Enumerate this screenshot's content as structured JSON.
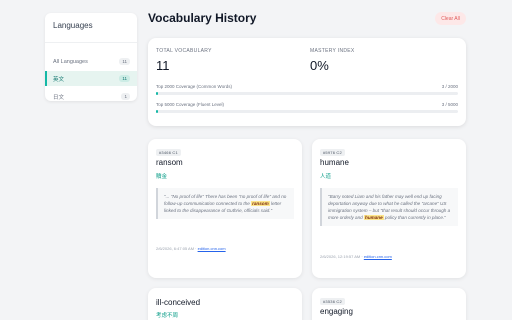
{
  "sidebar": {
    "title": "Languages",
    "items": [
      {
        "label": "All Languages",
        "count": "11"
      },
      {
        "label": "英文",
        "count": "11"
      },
      {
        "label": "日文",
        "count": "1"
      }
    ]
  },
  "header": {
    "title": "Vocabulary History",
    "clear_label": "Clear All"
  },
  "stats": {
    "total_label": "TOTAL VOCABULARY",
    "total_value": "11",
    "mastery_label": "MASTERY INDEX",
    "mastery_value": "0%",
    "coverage": [
      {
        "label": "Top 2000 Coverage (Common Words)",
        "value": "3 / 2000",
        "fraction": 0.0015
      },
      {
        "label": "Top 5000 Coverage (Fluent Level)",
        "value": "3 / 5000",
        "fraction": 0.0006
      }
    ]
  },
  "cards": [
    {
      "tag": "#3466 C1",
      "word": "ransom",
      "translation": "贖金",
      "quote_pre": "\"... \"No proof of life\" There has been \"no proof of life\" and no follow-up communication connected to the ",
      "quote_hl": "ransom",
      "quote_post": " letter linked to the disappearance of Guthrie, officials said.\"",
      "date": "2/6/2026, 6:47:05 AM · ",
      "link": "edition.cnn.com"
    },
    {
      "tag": "#5976 C2",
      "word": "humane",
      "translation": "人道",
      "quote_pre": "\"Barry noted Liam and his father may well end up facing deportation anyway due to what he called the \"arcane\" US immigration system – but \"that result should occur through a more orderly and ",
      "quote_hl": "humane",
      "quote_post": " policy than currently in place.\"",
      "date": "2/6/2026, 12:19:57 AM · ",
      "link": "edition.cnn.com"
    },
    {
      "word": "ill-conceived",
      "translation": "考虑不周"
    },
    {
      "tag": "#3536 C2",
      "word": "engaging"
    }
  ]
}
